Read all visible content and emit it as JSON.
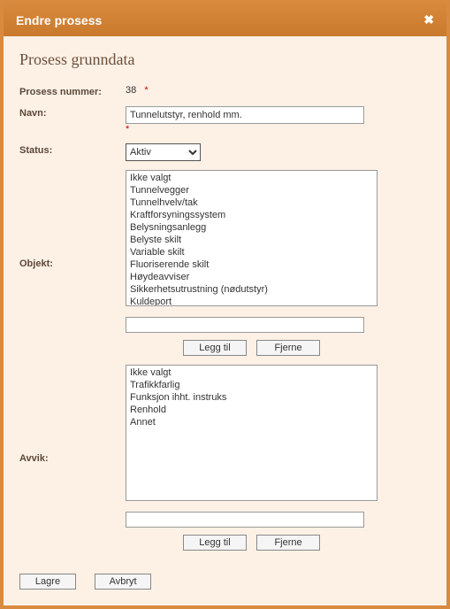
{
  "window": {
    "title": "Endre prosess"
  },
  "heading": "Prosess grunndata",
  "labels": {
    "prosess_nummer": "Prosess nummer:",
    "navn": "Navn:",
    "status": "Status:",
    "objekt": "Objekt:",
    "avvik": "Avvik:"
  },
  "values": {
    "prosess_nummer": "38",
    "navn": "Tunnelutstyr, renhold mm.",
    "status_selected": "Aktiv"
  },
  "status_options": [
    "Aktiv"
  ],
  "objekt_list": [
    "Ikke valgt",
    "Tunnelvegger",
    "Tunnelhvelv/tak",
    "Kraftforsyningssystem",
    "Belysningsanlegg",
    "Belyste skilt",
    "Variable skilt",
    "Fluoriserende skilt",
    "Høydeavviser",
    "Sikkerhetsutrustning (nødutstyr)",
    "Kuldeport"
  ],
  "avvik_list": [
    "Ikke valgt",
    "Trafikkfarlig",
    "Funksjon ihht. instruks",
    "Renhold",
    "Annet"
  ],
  "buttons": {
    "legg_til": "Legg til",
    "fjerne": "Fjerne",
    "lagre": "Lagre",
    "avbryt": "Avbryt"
  },
  "required_marker": "*"
}
